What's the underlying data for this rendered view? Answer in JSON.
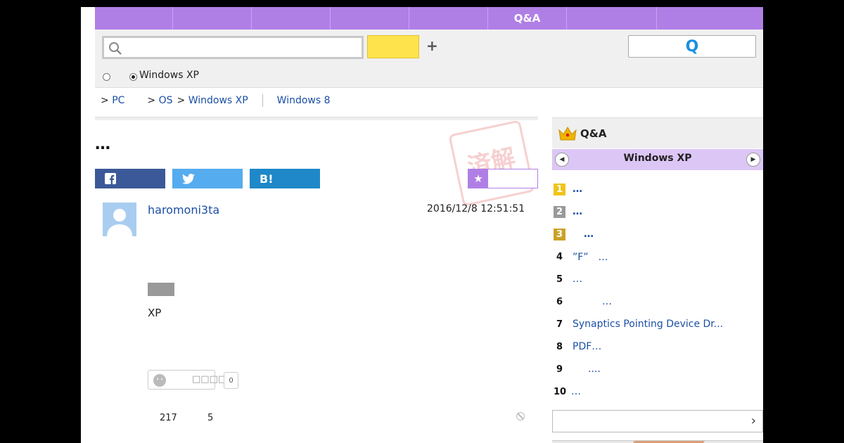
{
  "nav": {
    "items": [
      "",
      "",
      "",
      "",
      "",
      "Q&A",
      "",
      ""
    ]
  },
  "search": {
    "placeholder": "",
    "search_button_label": "",
    "plus_label": "+",
    "q_button_label": "Q",
    "radio_option_label": "Windows XP"
  },
  "breadcrumb": {
    "prefix1": ">",
    "item1": "PC",
    "prefix2": ">",
    "item2": "OS",
    "prefix3": ">",
    "item3": "Windows XP",
    "related": "Windows 8"
  },
  "question": {
    "title": "…",
    "stamp_text": "済解",
    "share": {
      "facebook_icon": "f",
      "twitter_icon": "twitter-bird",
      "hatena_label": "B!"
    },
    "favorite_label": "",
    "username": "haromoni3ta",
    "datetime": "2016/12/8  12:51:51",
    "body_text": "XP",
    "reaction_boxes": "□□□□",
    "reaction_count": "0",
    "view_count": "217",
    "answer_count": "5"
  },
  "sidebar": {
    "header": "Q&A",
    "category": "Windows XP",
    "ranking": [
      {
        "rank": "1",
        "text": "…",
        "style": "gold"
      },
      {
        "rank": "2",
        "text": "…",
        "style": "silver"
      },
      {
        "rank": "3",
        "text": "  …",
        "style": "bronze"
      },
      {
        "rank": "4",
        "text": "”F”　…",
        "style": "plain"
      },
      {
        "rank": "5",
        "text": "…",
        "style": "plain"
      },
      {
        "rank": "6",
        "text": "         …",
        "style": "plain"
      },
      {
        "rank": "7",
        "text": "Synaptics Pointing Device Dr...",
        "style": "plain"
      },
      {
        "rank": "8",
        "text": "PDF…",
        "style": "plain"
      },
      {
        "rank": "9",
        "text": "      ....",
        "style": "plain"
      },
      {
        "rank": "10",
        "text": "…",
        "style": "plain"
      }
    ],
    "more_label": ""
  },
  "colors": {
    "accent_purple": "#b07fe6",
    "link_blue": "#1b4fa5",
    "search_yellow": "#ffe34d",
    "facebook": "#3b5998",
    "twitter": "#55acee",
    "hatena": "#1e88c9"
  }
}
